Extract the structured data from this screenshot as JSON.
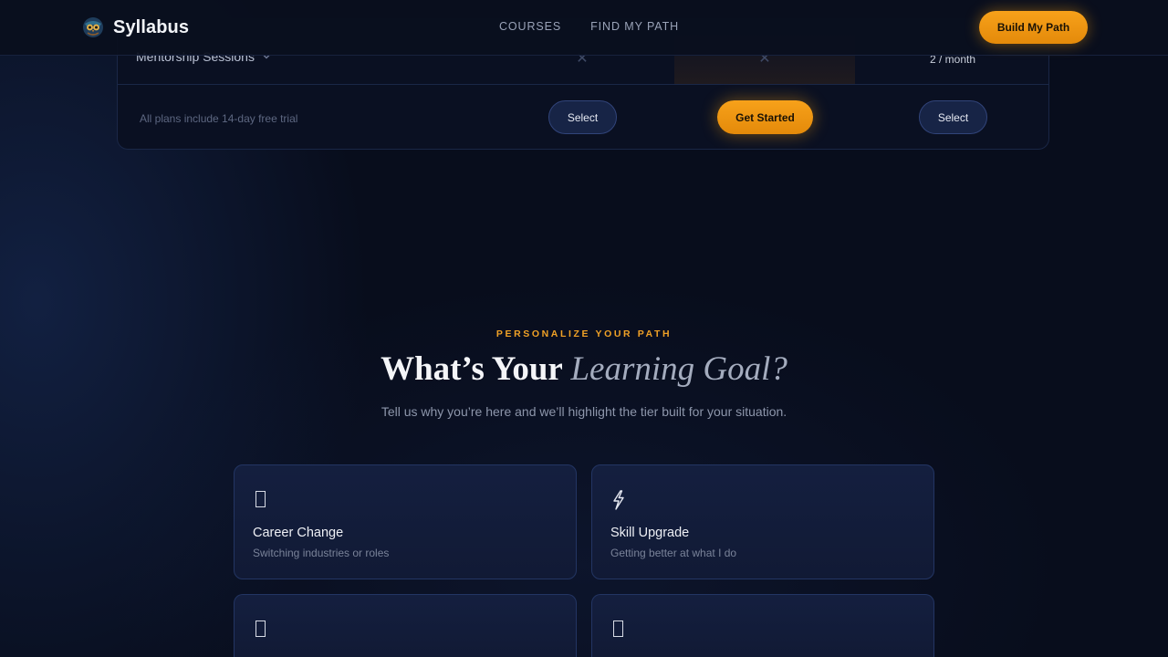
{
  "nav": {
    "brand": "Syllabus",
    "links": [
      "COURSES",
      "FIND MY PATH"
    ],
    "cta": "Build My Path"
  },
  "pricing": {
    "feature_label": "Mentorship Sessions",
    "col1_value": "✕",
    "col2_value": "✕",
    "col3_value": "2 / month",
    "trial_note": "All plans include 14-day free trial",
    "select_label": "Select",
    "get_started_label": "Get Started"
  },
  "goal_section": {
    "eyebrow": "PERSONALIZE YOUR PATH",
    "title_strong": "What’s Your",
    "title_em": "Learning Goal?",
    "subtitle": "Tell us why you’re here and we’ll highlight the tier built for your situation.",
    "cards": [
      {
        "icon": "box-icon",
        "title": "Career Change",
        "desc": "Switching industries or roles"
      },
      {
        "icon": "lightning-icon",
        "title": "Skill Upgrade",
        "desc": "Getting better at what I do"
      },
      {
        "icon": "box-icon"
      },
      {
        "icon": "box-icon"
      }
    ]
  },
  "colors": {
    "accent": "#f59e0b",
    "background": "#080d1c",
    "card": "#141f3f",
    "card_border": "#233563"
  }
}
